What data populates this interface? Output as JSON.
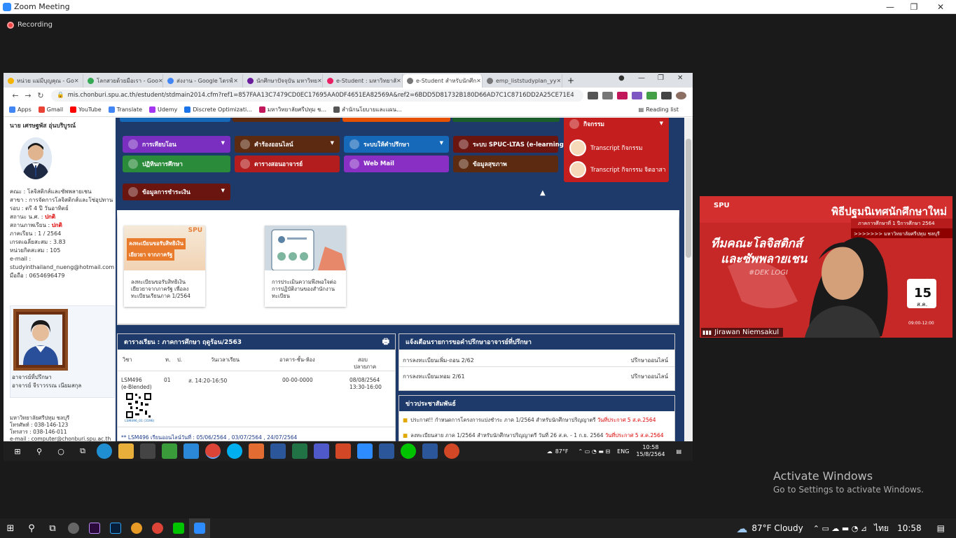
{
  "zoom": {
    "title": "Zoom Meeting",
    "minimize": "—",
    "maximize": "❐",
    "close": "✕",
    "recording_label": "Recording"
  },
  "browser": {
    "tabs": [
      {
        "label": "หน่วย แม่มีบุญคุณ - Go",
        "color": "#f4b400",
        "active": false
      },
      {
        "label": "โลกสวยด้วยมือเรา - Goo",
        "color": "#34a853",
        "active": false
      },
      {
        "label": "ส่งงาน - Google ไดรฟ์",
        "color": "#4285f4",
        "active": false
      },
      {
        "label": "นักศึกษาปัจจุบัน มหาวิทย",
        "color": "#6a1b9a",
        "active": false
      },
      {
        "label": "e-Student : มหาวิทยาลั",
        "color": "#e91e63",
        "active": false
      },
      {
        "label": "e-Student สำหรับนักศึก",
        "color": "#777777",
        "active": true
      },
      {
        "label": "emp_liststudyplan_yy",
        "color": "#777777",
        "active": false
      }
    ],
    "new_tab": "+",
    "url": "mis.chonburi.spu.ac.th/estudent/stdmain2014.cfm?ref1=857FAA13C7479CD0EC17695AA0DF4651EA82569A&ref2=6BDD5D81732B180D66AD7C1C8716DD2A25CE71E4",
    "bookmarks": [
      {
        "label": "Apps",
        "color": "#4285f4"
      },
      {
        "label": "Gmail",
        "color": "#ea4335"
      },
      {
        "label": "YouTube",
        "color": "#ff0000"
      },
      {
        "label": "Translate",
        "color": "#4285f4"
      },
      {
        "label": "Udemy",
        "color": "#a435f0"
      },
      {
        "label": "Discrete Optimizati...",
        "color": "#1a73e8"
      },
      {
        "label": "มหาวิทยาลัยศรีปทุม ช...",
        "color": "#c2185b"
      },
      {
        "label": "สำนักนโยบายและแผน...",
        "color": "#555555"
      }
    ],
    "reading_list": "Reading list"
  },
  "student": {
    "name": "นาย เศรษฐพัส อุ่นบริบูรณ์",
    "faculty": "คณะ : โลจิสติกส์และซัพพลายเชน",
    "major": "สาขา : การจัดการโลจิสติกส์และโซ่อุปทาน",
    "round_label": "รอบ : ",
    "round_value": "ตรี 4 ปี วันอาทิตย์",
    "status_label": "สถานะ น.ศ. : ",
    "status_value": "ปกติ",
    "enroll_label": "สถานภาพเรียน : ",
    "enroll_value": "ปกติ",
    "semester": "ภาคเรียน : 1 / 2564",
    "gpa": "เกรดเฉลี่ยสะสม : 3.83",
    "credits": "หน่วยกิตสะสม : 105",
    "email_label": "e-mail :",
    "email": "studyinthailand_nueng@hotmail.com",
    "phone": "มือถือ : 0654696479",
    "advisor_title": "อาจารย์ที่ปรึกษา",
    "advisor_name": "อาจารย์ จีราวรรณ เนียมสกุล",
    "footer_uni": "มหาวิทยาลัยศรีปทุม ชลบุรี",
    "footer_tel": "โทรศัพท์ : 038-146-123",
    "footer_fax": "โทรสาร : 038-146-011",
    "footer_mail": "e-mail : computer@chonburi.spu.ac.th"
  },
  "menu": {
    "register": "การเทียบโอน",
    "petition": "คำร้องออนไลน์",
    "advisor_system": "ระบบให้คำปรึกษา",
    "ltas": "ระบบ SPUC-LTAS (e-learning)",
    "calendar": "ปฏิทินการศึกษา",
    "teacher_schedule": "ตารางสอนอาจารย์",
    "webmail": "Web Mail",
    "health": "ข้อมูลสุขภาพ",
    "payment": "ข้อมูลการชำระเงิน",
    "activity": "กิจกรรม",
    "transcript_activity": "Transcript กิจกรรม",
    "transcript_volunteer": "Transcript กิจกรรม จิตอาสา",
    "dropdown": "▼"
  },
  "cards": [
    {
      "banner_title": "ลงทะเบียนขอรับสิทธิเงิน",
      "banner_sub": "เยียวยา จากภาครัฐ",
      "badge": "SPU",
      "text": "ลงทะเบียนขอรับสิทธิเงินเยียวยาจากภาครัฐ เพื่อลงทะเบียนเรียนภาค 1/2564"
    },
    {
      "text": "การประเมินความพึงพอใจต่อการปฏิบัติงานของสำนักงานทะเบียน"
    }
  ],
  "schedule": {
    "title": "ตารางเรียน : ภาคการศึกษา ฤดูร้อน/2563",
    "print_icon": "🖶",
    "headers": [
      "วิชา",
      "ท.",
      "ป.",
      "วันเวลาเรียน",
      "อาคาร-ชั้น-ห้อง",
      "สอบ",
      "ปลายภาค"
    ],
    "row": {
      "code": "LSM496",
      "type": "(e-Blended)",
      "sec": "01",
      "time": "ส. 14:20-16:50",
      "room": "00-00-0000",
      "exam": "08/08/2564",
      "exam_time": "13:30-16:00"
    },
    "qr_caption": "LSM496_01 (3196)",
    "note": "** LSM496 เรียนออนไลน์วันที่ : 05/06/2564 ,  03/07/2564 ,  24/07/2564"
  },
  "advising": {
    "title": "แจ้งเตือนรายการขอคำปรึกษาอาจารย์ที่ปรึกษา",
    "rows": [
      {
        "label": "การลงทะเบียนเพิ่ม-ถอน 2/62",
        "action": "ปรึกษาออนไลน์"
      },
      {
        "label": "การลงทะเบียนเทอม 2/61",
        "action": "ปรึกษาออนไลน์"
      }
    ]
  },
  "news": {
    "title": "ข่าวประชาสัมพันธ์",
    "items": [
      {
        "text": "ประกาศ!! กำหนดการโครงการแบ่งชำระ ภาค 1/2564 สำหรับนักศึกษาปริญญาตรี",
        "date": "วันที่ประกาศ 5 ส.ค.2564"
      },
      {
        "text": "ลงทะเบียนสาย ภาค 1/2564 สำหรับนักศึกษาปริญญาตรี วันที่ 26 ส.ค. - 1 ก.ย. 2564",
        "date": "วันที่ประกาศ 5 ส.ค.2564"
      }
    ]
  },
  "inner_taskbar": {
    "weather": "87°F",
    "lang": "ENG",
    "time": "10:58",
    "date": "15/8/2564"
  },
  "video": {
    "participant": "Jirawan Niemsakul",
    "banner_title": "พิธีปฐมนิเทศนักศึกษาใหม่",
    "banner_sub1": "ภาคการศึกษาที่ 1 ปีการศึกษา 2564",
    "banner_sub2": ">>>>>>> มหาวิทยาลัยศรีปทุม ชลบุรี",
    "spu": "SPU",
    "big_text1": "ทีมคณะโลจิสติกส์",
    "big_text2": "และซัพพลายเชน",
    "hashtag": "#DEK LOGI",
    "day": "อาทิตย์",
    "day_num": "15",
    "month": "ส.ค.",
    "time": "09:00-12:00"
  },
  "activate": {
    "line1": "Activate Windows",
    "line2": "Go to Settings to activate Windows."
  },
  "main_taskbar": {
    "weather": "87°F  Cloudy",
    "lang": "ไทย",
    "time": "10:58"
  }
}
